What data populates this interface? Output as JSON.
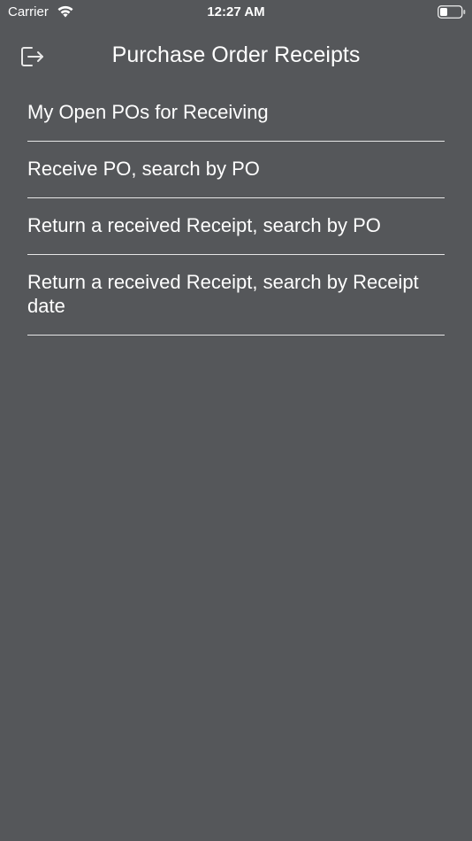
{
  "status_bar": {
    "carrier": "Carrier",
    "time": "12:27 AM",
    "wifi_icon": "wifi-icon",
    "battery_icon": "battery-icon"
  },
  "nav": {
    "title": "Purchase Order Receipts",
    "logout_icon": "logout-icon"
  },
  "menu": {
    "items": [
      {
        "label": "My Open POs for Receiving"
      },
      {
        "label": "Receive PO, search by PO"
      },
      {
        "label": "Return a received Receipt, search by PO"
      },
      {
        "label": "Return a received Receipt, search by Receipt date"
      }
    ]
  },
  "colors": {
    "background": "#55575a",
    "text": "#ffffff",
    "divider": "#e6e6e6"
  }
}
